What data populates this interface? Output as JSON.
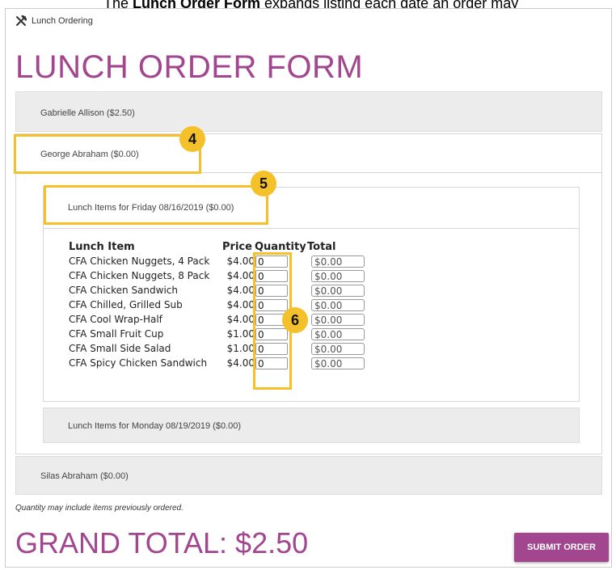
{
  "caption": {
    "prefix": "The ",
    "bold": "Lunch Order Form",
    "suffix": " expands listing each date an order may"
  },
  "breadcrumb": {
    "icon": "fork-knife-icon",
    "label": "Lunch Ordering"
  },
  "page_title": "LUNCH ORDER FORM",
  "students": [
    {
      "label": "Gabrielle Allison ($2.50)"
    },
    {
      "label": "George Abraham ($0.00)"
    },
    {
      "label": "Silas Abraham ($0.00)"
    }
  ],
  "days": [
    {
      "label": "Lunch Items for Friday 08/16/2019 ($0.00)"
    },
    {
      "label": "Lunch Items for Monday 08/19/2019 ($0.00)"
    }
  ],
  "table": {
    "headers": {
      "item": "Lunch Item",
      "price": "Price",
      "quantity": "Quantity",
      "total": "Total"
    },
    "rows": [
      {
        "name": "CFA Chicken Nuggets, 4 Pack",
        "price": "$4.00",
        "qty": "0",
        "total": "$0.00"
      },
      {
        "name": "CFA Chicken Nuggets, 8 Pack",
        "price": "$4.00",
        "qty": "0",
        "total": "$0.00"
      },
      {
        "name": "CFA Chicken Sandwich",
        "price": "$4.00",
        "qty": "0",
        "total": "$0.00"
      },
      {
        "name": "CFA Chilled, Grilled Sub",
        "price": "$4.00",
        "qty": "0",
        "total": "$0.00"
      },
      {
        "name": "CFA Cool Wrap-Half",
        "price": "$4.00",
        "qty": "0",
        "total": "$0.00"
      },
      {
        "name": "CFA Small Fruit Cup",
        "price": "$1.00",
        "qty": "0",
        "total": "$0.00"
      },
      {
        "name": "CFA Small Side Salad",
        "price": "$1.00",
        "qty": "0",
        "total": "$0.00"
      },
      {
        "name": "CFA Spicy Chicken Sandwich",
        "price": "$4.00",
        "qty": "0",
        "total": "$0.00"
      }
    ]
  },
  "callouts": [
    "4",
    "5",
    "6"
  ],
  "note": "Quantity may include items previously ordered.",
  "grand_total": "GRAND TOTAL: $2.50",
  "submit_label": "SUBMIT ORDER",
  "colors": {
    "brand": "#a2468f",
    "callout": "#f5c12a"
  }
}
